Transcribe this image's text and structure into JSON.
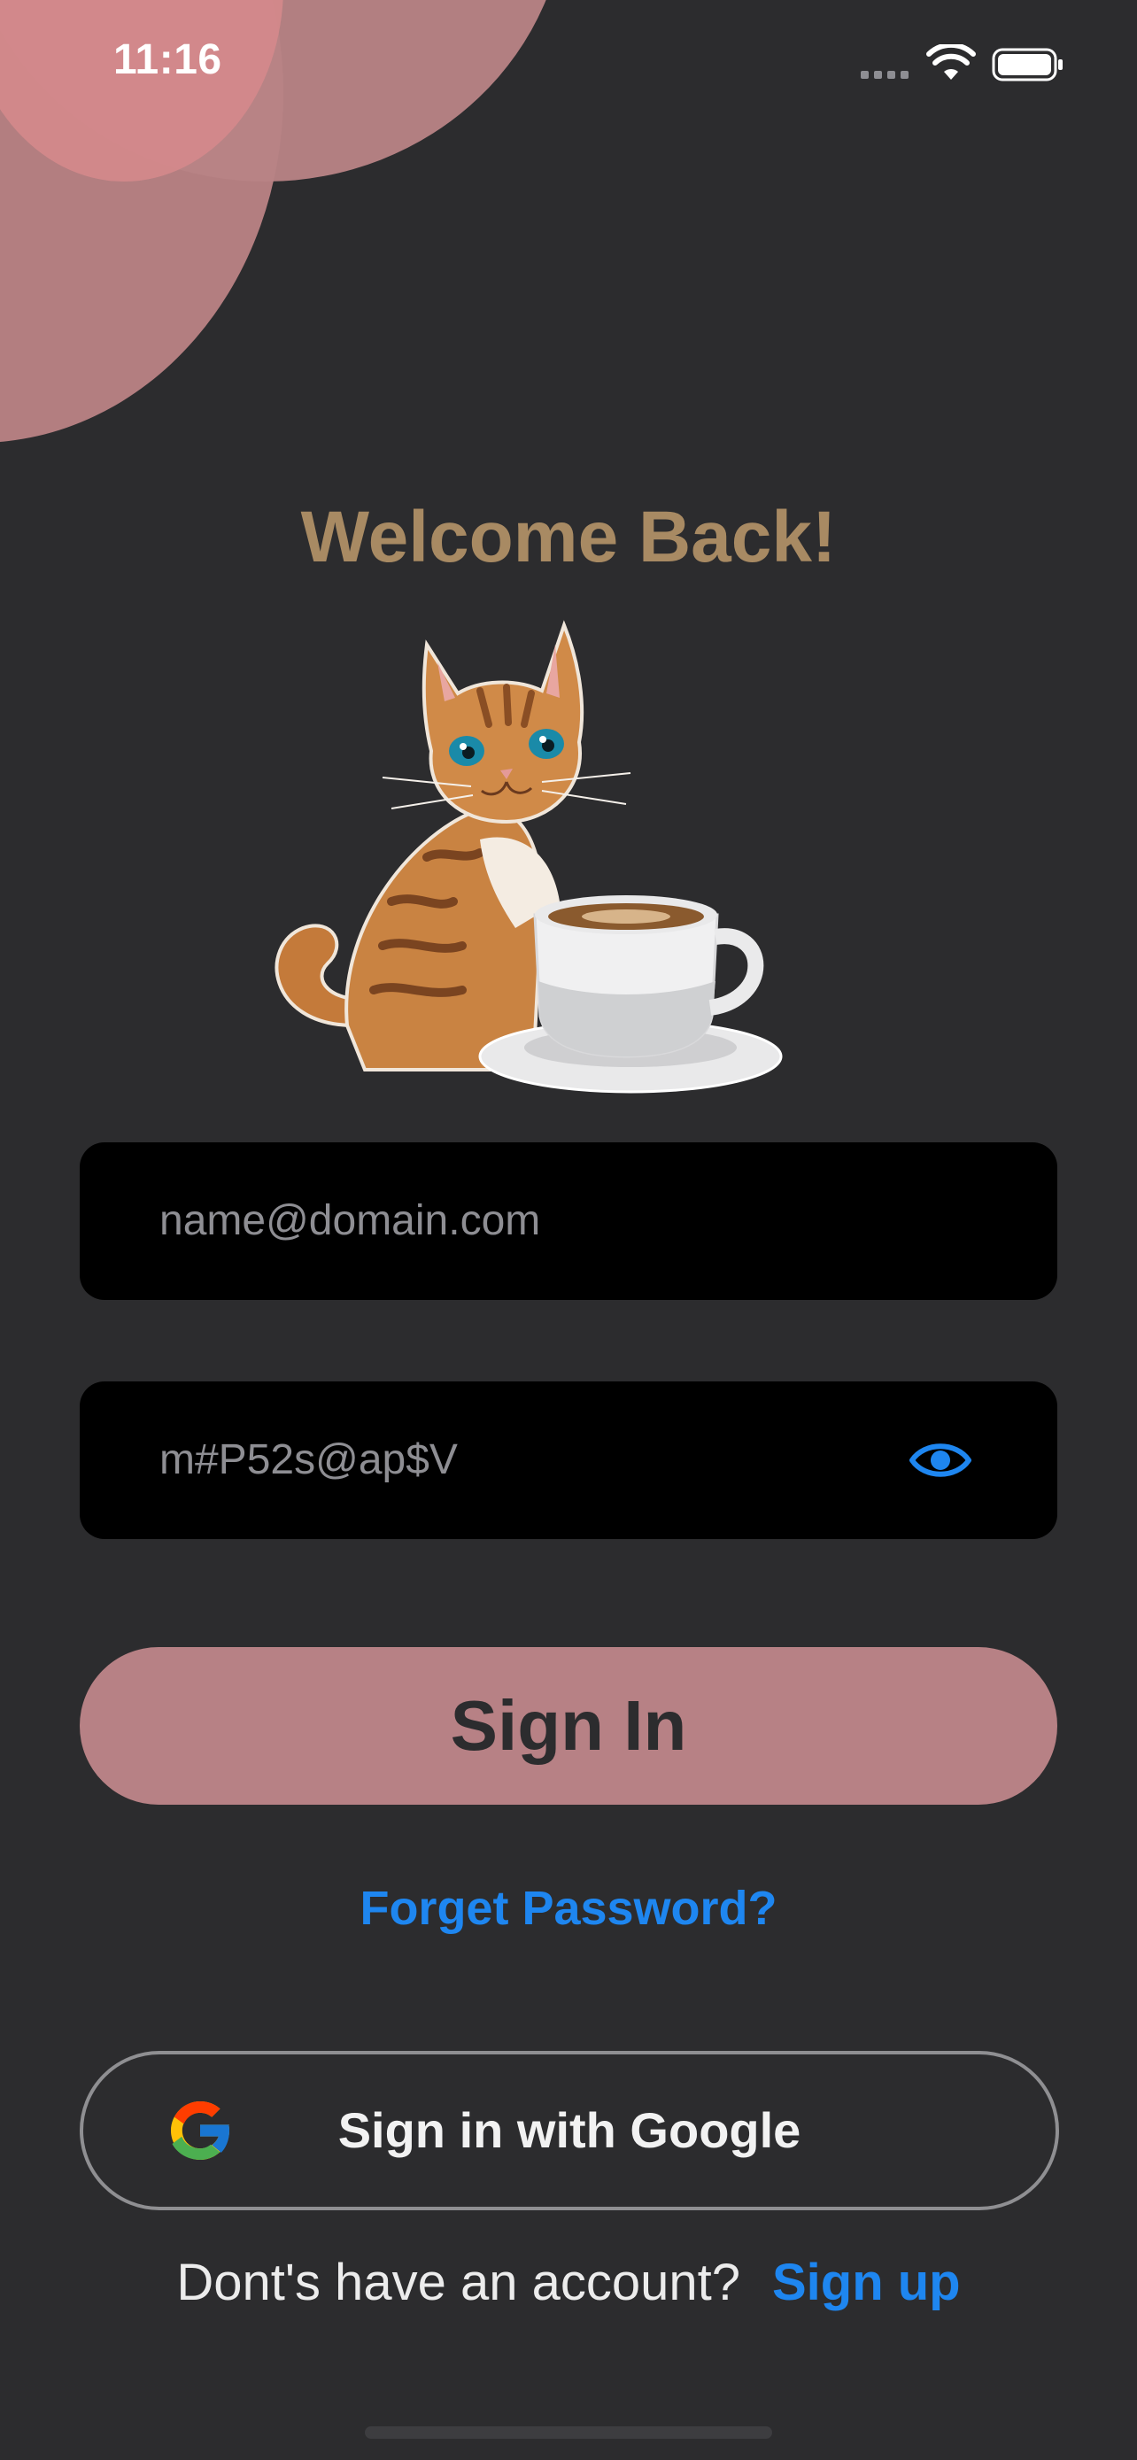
{
  "status_bar": {
    "time": "11:16",
    "icons": [
      "signal-icon",
      "wifi-icon",
      "battery-icon"
    ]
  },
  "welcome": {
    "title": "Welcome Back!"
  },
  "hero_image": {
    "icon": "cat-with-coffee-illustration"
  },
  "email": {
    "placeholder": "name@domain.com",
    "value": ""
  },
  "password": {
    "value": "m#P52s@ap$V",
    "visibility_icon": "eye-icon"
  },
  "buttons": {
    "sign_in": "Sign In",
    "forgot_password": "Forget Password?",
    "google": "Sign in with Google",
    "google_icon": "google-logo-icon"
  },
  "footer": {
    "question": "Dont's have an account?",
    "sign_up": "Sign up"
  },
  "colors": {
    "background": "#2c2c2e",
    "accent_pink": "#b78185",
    "title_gold": "#a88a63",
    "link_blue": "#1e86f0"
  }
}
